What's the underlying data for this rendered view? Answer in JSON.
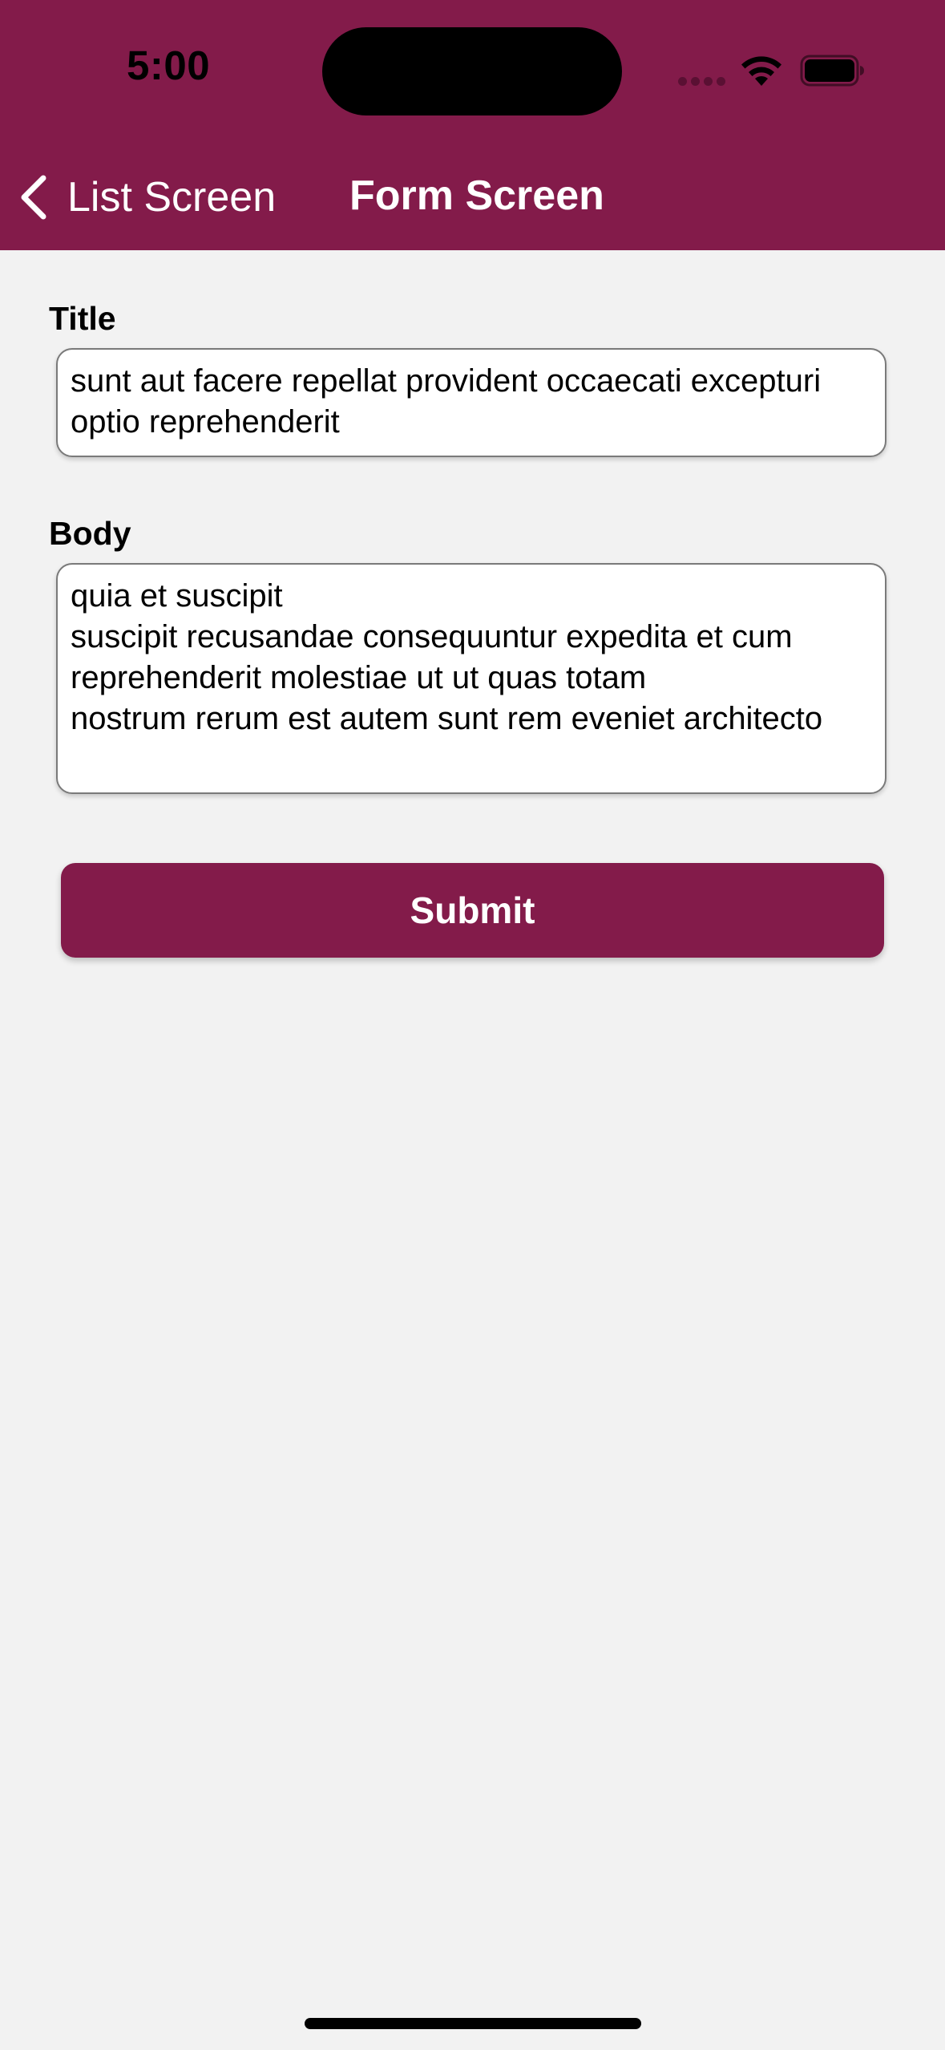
{
  "status_bar": {
    "time": "5:00",
    "icons": [
      "signal-icon",
      "wifi-icon",
      "battery-icon"
    ]
  },
  "nav_bar": {
    "back_label": "List Screen",
    "back_icon": "chevron-left-icon",
    "title": "Form Screen"
  },
  "form": {
    "title_label": "Title",
    "title_value": "sunt aut facere repellat provident occaecati excepturi optio reprehenderit",
    "body_label": "Body",
    "body_value": "quia et suscipit\nsuscipit recusandae consequuntur expedita et cum reprehenderit molestiae ut ut quas totam\nnostrum rerum est autem sunt rem eveniet architecto",
    "submit_label": "Submit"
  },
  "colors": {
    "brand": "#831b4a",
    "background": "#f2f2f2"
  }
}
